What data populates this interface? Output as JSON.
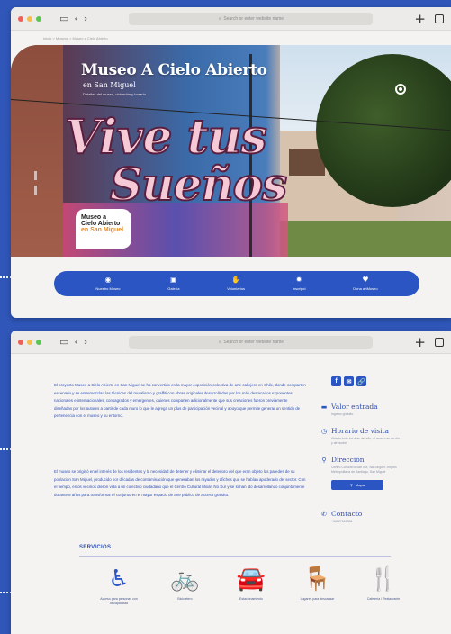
{
  "browser_1": {
    "address": "Search or enter website name"
  },
  "browser_2": {
    "address": "Search or enter website name"
  },
  "hero": {
    "breadcrumb": "Inicio  >  Museos  >  Museo a Cielo Abierto",
    "title": "Museo A Cielo Abierto",
    "subtitle": "en San Miguel",
    "description": "Detalles del museo, ubicación y horario",
    "mural_line1": "Vive tus",
    "mural_line2": "Sueños",
    "logo_line1": "Museo a",
    "logo_line2": "Cielo Abierto",
    "logo_line3": "en San Miguel"
  },
  "nav": [
    {
      "icon": "◉",
      "label": "Nuestro Museo"
    },
    {
      "icon": "▣",
      "label": "Galería"
    },
    {
      "icon": "✋",
      "label": "Voluntarios"
    },
    {
      "icon": "✹",
      "label": "Inscripci"
    },
    {
      "icon": "♥",
      "label": "Dona artMuseo"
    }
  ],
  "about": {
    "p1": "El proyecto Museo a Cielo Abierto en San Miguel se ha convertido en la mayor exposición colectiva de arte callejero en Chile, donde comparten escenario y se entremezclan las técnicas del muralismo y graffiti con obras originales desarrolladas por los más destacados exponentes nacionales e internacionales, consagrados y emergentes, quienes comparten adicionalmente que sus creaciones fueron previamente diseñadas por los autores a partir de cada muro lo que le agrega un plus de participación vecinal y apoyo que permite generar un sentido de pertenencia con el museo y su entorno.",
    "p2": "El museo se originó en el interés de los residentes y la necesidad de detener y eliminar el deterioro del que eran objeto las paredes de su población San Miguel, producido por décadas de contaminación que generaban los rayados y afiches que se habían apoderado del sector. Con el tiempo, estos vecinos dieron vida a un colectivo ciudadano que el Centro Cultural Mixart No Sur y se lo han ido desarrollando conjuntamente durante 8 años para transformar el conjunto en el mayor espacio de arte público de acceso gratuito."
  },
  "social": [
    "f",
    "✉",
    "🔗"
  ],
  "info": {
    "entry_title": "Valor entrada",
    "entry_sub": "Ingreso gratuito",
    "hours_title": "Horario de visita",
    "hours_sub": "Abierto todo los días del año, el museo es de día y de noche",
    "address_title": "Dirección",
    "address_sub": "Centro Cultural Mixart Sur, San Miguel. Región Metropolitana de Santiago, San Miguel",
    "map_button": "Mapa",
    "contact_title": "Contacto",
    "contact_sub": "+56227612384"
  },
  "services": {
    "title": "SERVICIOS",
    "items": [
      {
        "icon": "♿",
        "label": "Acceso para personas con discapacidad"
      },
      {
        "icon": "🚲",
        "label": "Bicicletero"
      },
      {
        "icon": "🚘",
        "label": "Estacionamiento"
      },
      {
        "icon": "🪑",
        "label": "Lugares para descansar"
      },
      {
        "icon": "🍴",
        "label": "Cafetería / Restaurante"
      }
    ]
  },
  "colors": {
    "brand_blue": "#2a55c2",
    "background": "#2f56b8",
    "text_blue": "#2f4fb4"
  }
}
